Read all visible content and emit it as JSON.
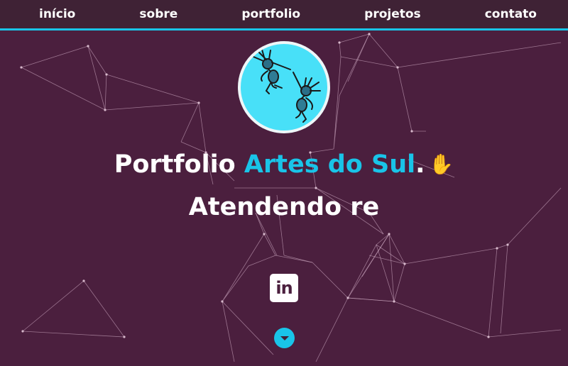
{
  "nav": {
    "items": [
      {
        "label": "início"
      },
      {
        "label": "sobre"
      },
      {
        "label": "portfolio"
      },
      {
        "label": "projetos"
      },
      {
        "label": "contato"
      }
    ]
  },
  "hero": {
    "title_prefix": "Portfolio ",
    "title_accent": "Artes do Sul",
    "title_suffix": ".",
    "wave_icon": "waving-hand-icon",
    "typing_text": "Atendendo re"
  },
  "social": {
    "linkedin_label": "in",
    "linkedin_icon": "linkedin-icon"
  },
  "scroll": {
    "icon": "chevron-down-icon"
  },
  "colors": {
    "background": "#4b1f3e",
    "navbar": "#3f2235",
    "accent": "#19c4e8",
    "text": "#ffffff",
    "network_lines": "#c9a4bd"
  }
}
